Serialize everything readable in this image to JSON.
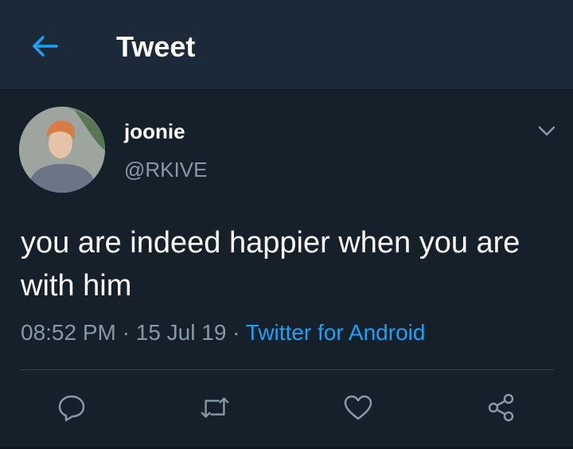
{
  "header": {
    "title": "Tweet"
  },
  "tweet": {
    "name": "joonie",
    "handle": "@RKIVE",
    "text": "you are indeed happier when you are with him",
    "time": "08:52 PM",
    "date": "15 Jul 19",
    "source": "Twitter for Android",
    "separator": " · "
  },
  "icons": {
    "back": "back-arrow-icon",
    "more": "chevron-down-icon",
    "reply": "reply-icon",
    "retweet": "retweet-icon",
    "like": "heart-icon",
    "share": "share-icon"
  },
  "colors": {
    "background": "#15202b",
    "header": "#1c2938",
    "accent": "#1da1f2",
    "secondary_text": "#8899a6"
  }
}
